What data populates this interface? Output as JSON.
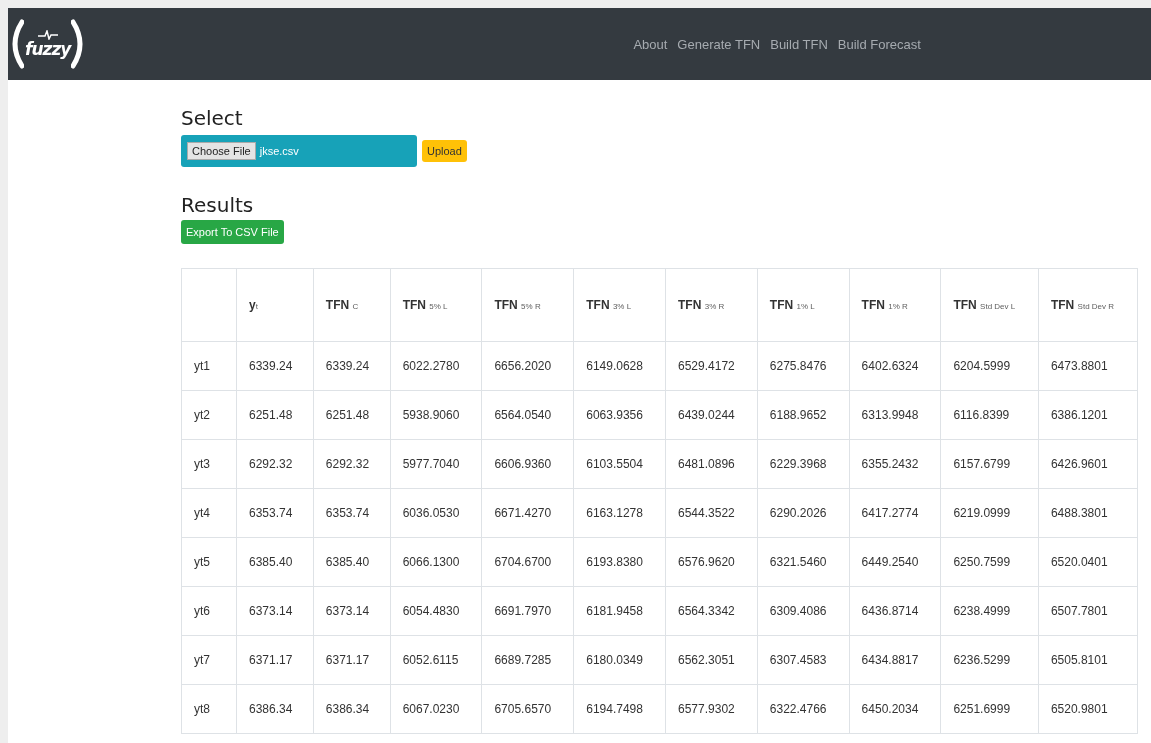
{
  "navbar": {
    "logo_text": "fuzzy",
    "links": [
      "About",
      "Generate TFN",
      "Build TFN",
      "Build Forecast"
    ]
  },
  "select": {
    "heading": "Select",
    "choose_button": "Choose File",
    "file_name": "jkse.csv",
    "upload_button": "Upload"
  },
  "results": {
    "heading": "Results",
    "export_button": "Export To CSV File"
  },
  "table": {
    "columns": [
      "",
      "y$_{t}$",
      "TFN $_{C}$",
      "TFN $_{5% L}$",
      "TFN $_{5% R}$",
      "TFN $_{3% L}$",
      "TFN $_{3% R}$",
      "TFN $_{1% L}$",
      "TFN $_{1% R}$",
      "TFN $_{Std Dev L}$",
      "TFN $_{Std Dev R}$"
    ],
    "rows": [
      [
        "yt1",
        "6339.24",
        "6339.24",
        "6022.2780",
        "6656.2020",
        "6149.0628",
        "6529.4172",
        "6275.8476",
        "6402.6324",
        "6204.5999",
        "6473.8801"
      ],
      [
        "yt2",
        "6251.48",
        "6251.48",
        "5938.9060",
        "6564.0540",
        "6063.9356",
        "6439.0244",
        "6188.9652",
        "6313.9948",
        "6116.8399",
        "6386.1201"
      ],
      [
        "yt3",
        "6292.32",
        "6292.32",
        "5977.7040",
        "6606.9360",
        "6103.5504",
        "6481.0896",
        "6229.3968",
        "6355.2432",
        "6157.6799",
        "6426.9601"
      ],
      [
        "yt4",
        "6353.74",
        "6353.74",
        "6036.0530",
        "6671.4270",
        "6163.1278",
        "6544.3522",
        "6290.2026",
        "6417.2774",
        "6219.0999",
        "6488.3801"
      ],
      [
        "yt5",
        "6385.40",
        "6385.40",
        "6066.1300",
        "6704.6700",
        "6193.8380",
        "6576.9620",
        "6321.5460",
        "6449.2540",
        "6250.7599",
        "6520.0401"
      ],
      [
        "yt6",
        "6373.14",
        "6373.14",
        "6054.4830",
        "6691.7970",
        "6181.9458",
        "6564.3342",
        "6309.4086",
        "6436.8714",
        "6238.4999",
        "6507.7801"
      ],
      [
        "yt7",
        "6371.17",
        "6371.17",
        "6052.6115",
        "6689.7285",
        "6180.0349",
        "6562.3051",
        "6307.4583",
        "6434.8817",
        "6236.5299",
        "6505.8101"
      ],
      [
        "yt8",
        "6386.34",
        "6386.34",
        "6067.0230",
        "6705.6570",
        "6194.7498",
        "6577.9302",
        "6322.4766",
        "6450.2034",
        "6251.6999",
        "6520.9801"
      ]
    ]
  }
}
